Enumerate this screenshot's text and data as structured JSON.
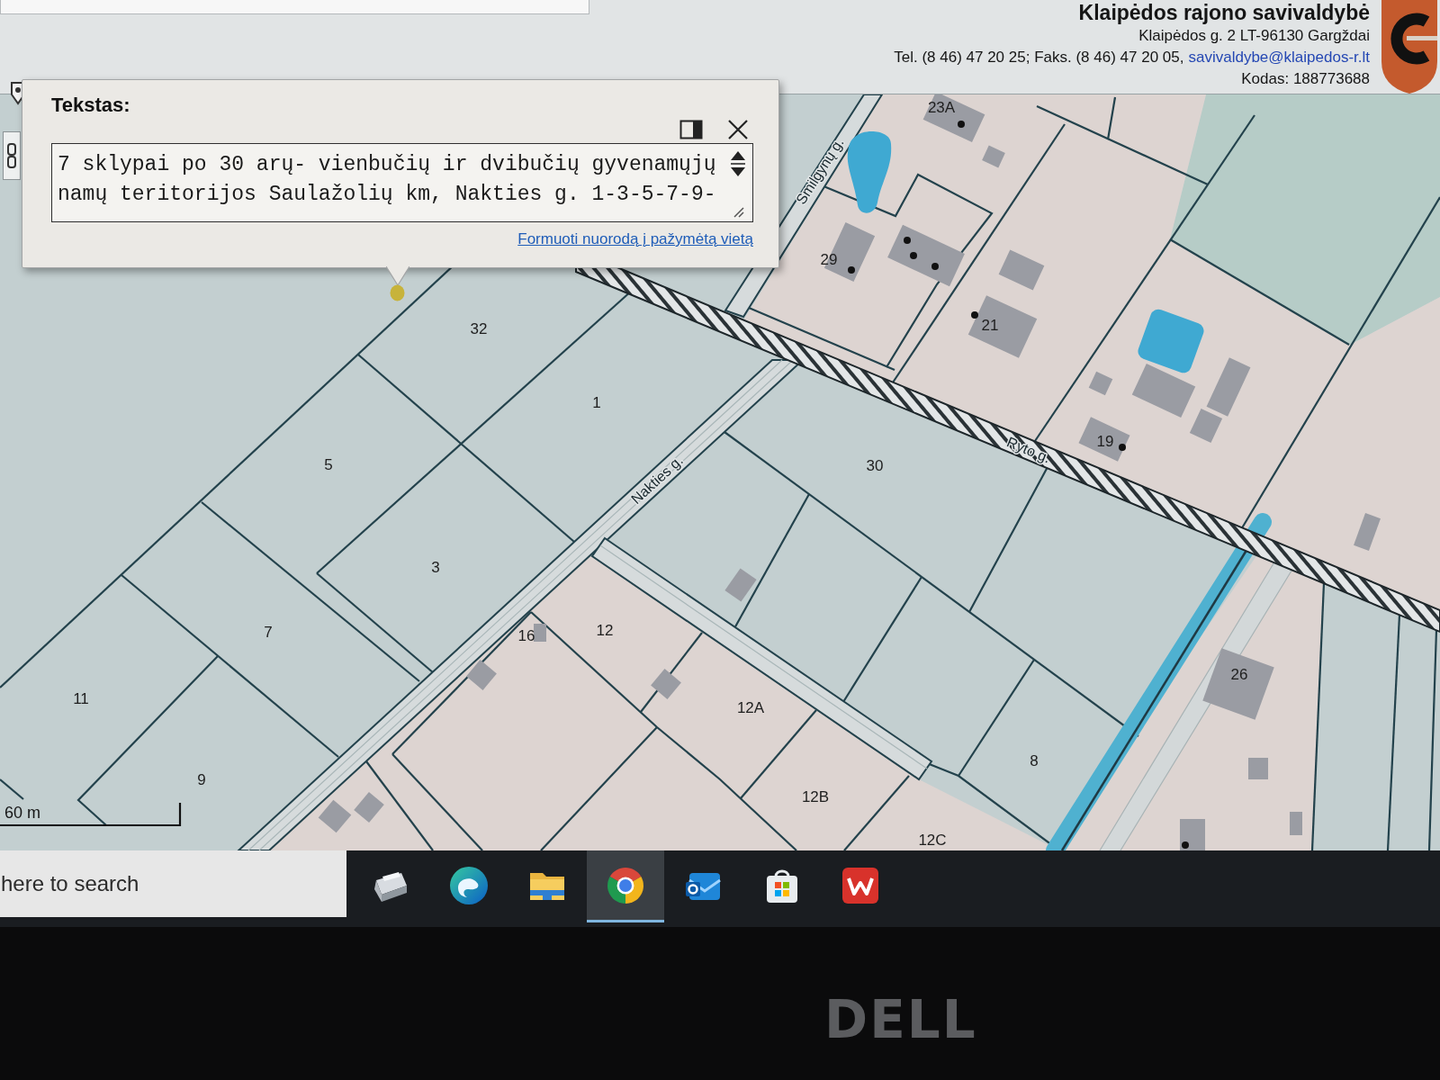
{
  "header": {
    "title": "Klaipėdos rajono savivaldybė",
    "address": "Klaipėdos g. 2 LT-96130 Gargždai",
    "contacts": "Tel. (8 46) 47 20 25; Faks. (8 46) 47 20 05,",
    "email": "savivaldybe@klaipedos-r.lt",
    "code": "Kodas: 188773688"
  },
  "popup": {
    "title": "Tekstas:",
    "text": "7 sklypai po 30 arų- vienbučių ir dvibučių gyvenamųjų namų teritorijos Saulažolių km, Nakties g. 1-3-5-7-9-",
    "link": "Formuoti nuorodą į pažymėtą vietą"
  },
  "map": {
    "streets": [
      {
        "name": "Smilgynų g."
      },
      {
        "name": "Ryto g."
      },
      {
        "name": "Nakties g."
      }
    ],
    "parcels": [
      {
        "number": "23A"
      },
      {
        "number": "29"
      },
      {
        "number": "32"
      },
      {
        "number": "21"
      },
      {
        "number": "1"
      },
      {
        "number": "19"
      },
      {
        "number": "5"
      },
      {
        "number": "30"
      },
      {
        "number": "3"
      },
      {
        "number": "7"
      },
      {
        "number": "16"
      },
      {
        "number": "12"
      },
      {
        "number": "26"
      },
      {
        "number": "11"
      },
      {
        "number": "12A"
      },
      {
        "number": "8"
      },
      {
        "number": "9"
      },
      {
        "number": "12B"
      },
      {
        "number": "12C"
      }
    ],
    "scale": "60 m"
  },
  "taskbar": {
    "search": {
      "placeholder": "here to search"
    },
    "apps": [
      {
        "kind": "scanner",
        "selected": false
      },
      {
        "kind": "edge",
        "selected": false
      },
      {
        "kind": "folder",
        "selected": false
      },
      {
        "kind": "chrome",
        "selected": true
      },
      {
        "kind": "mail",
        "selected": false
      },
      {
        "kind": "store",
        "selected": false
      },
      {
        "kind": "wps",
        "selected": false
      }
    ]
  },
  "bezel": {
    "logo": "DELL"
  }
}
